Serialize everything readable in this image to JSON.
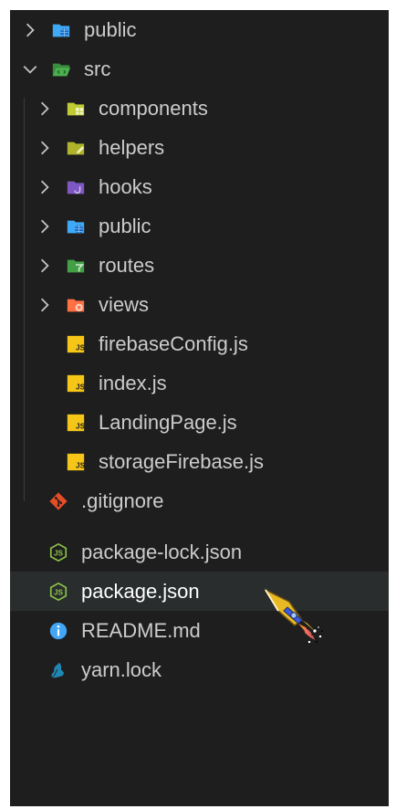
{
  "colors": {
    "panel_bg": "#1e1e1e",
    "text": "#cccccc",
    "selected_bg": "#2a2d2e",
    "selected_text": "#ffffff",
    "folder_public": "#3fa9f5",
    "folder_src": "#4caf50",
    "folder_components": "#c0ca33",
    "folder_helpers": "#afb42b",
    "folder_hooks": "#7e57c2",
    "folder_routes": "#43a047",
    "folder_views": "#ff7043",
    "js_badge": "#f5c518",
    "git_icon": "#e44d26",
    "node_icon": "#8bc34a",
    "info_icon": "#42a5f5",
    "yarn_icon": "#2188b6"
  },
  "explorer": {
    "items": [
      {
        "label": "public",
        "icon": "folder-public-icon",
        "chevron": "right"
      },
      {
        "label": "src",
        "icon": "folder-src-open-icon",
        "chevron": "down"
      },
      {
        "label": "components",
        "icon": "folder-components-icon",
        "chevron": "right"
      },
      {
        "label": "helpers",
        "icon": "folder-helpers-icon",
        "chevron": "right"
      },
      {
        "label": "hooks",
        "icon": "folder-hooks-icon",
        "chevron": "right"
      },
      {
        "label": "public",
        "icon": "folder-public-icon",
        "chevron": "right"
      },
      {
        "label": "routes",
        "icon": "folder-routes-icon",
        "chevron": "right"
      },
      {
        "label": "views",
        "icon": "folder-views-icon",
        "chevron": "right"
      },
      {
        "label": "firebaseConfig.js",
        "icon": "javascript-file-icon"
      },
      {
        "label": "index.js",
        "icon": "javascript-file-icon"
      },
      {
        "label": "LandingPage.js",
        "icon": "javascript-file-icon"
      },
      {
        "label": "storageFirebase.js",
        "icon": "javascript-file-icon"
      },
      {
        "label": ".gitignore",
        "icon": "git-icon"
      },
      {
        "label": "package-lock.json",
        "icon": "nodejs-icon"
      },
      {
        "label": "package.json",
        "icon": "nodejs-icon",
        "selected": true
      },
      {
        "label": "README.md",
        "icon": "info-icon"
      },
      {
        "label": "yarn.lock",
        "icon": "yarn-icon"
      }
    ]
  },
  "cursor": {
    "icon": "rocket-cursor-icon"
  }
}
